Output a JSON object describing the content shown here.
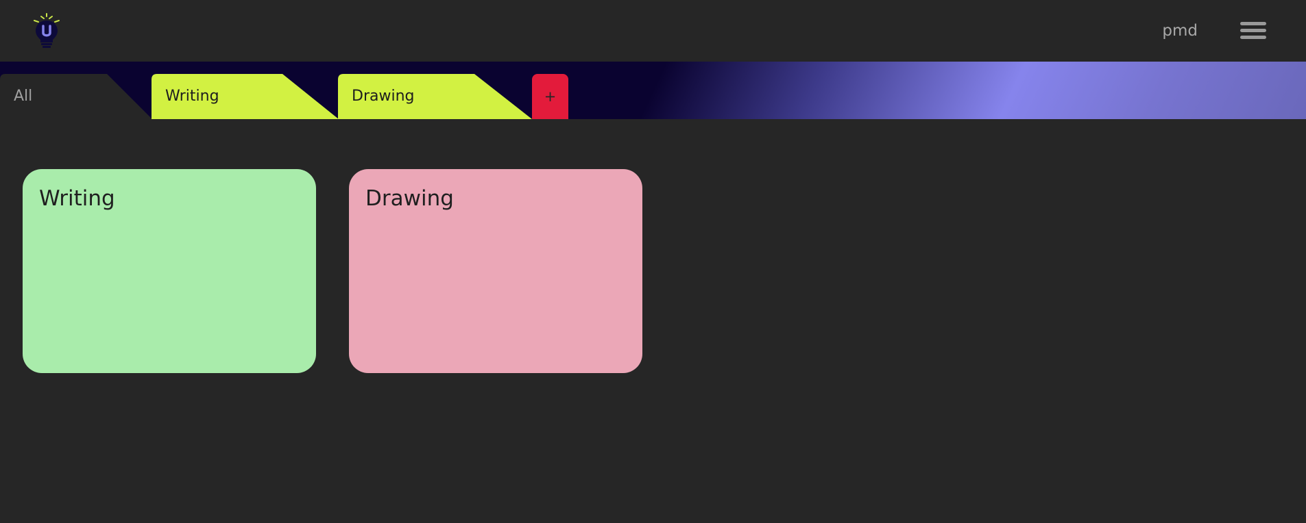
{
  "header": {
    "logo_icon": "lightbulb-logo-icon",
    "username": "pmd",
    "menu_icon": "hamburger-menu-icon"
  },
  "tabs": [
    {
      "label": "All",
      "color": "#262626",
      "active": true
    },
    {
      "label": "Writing",
      "color": "#d2f142",
      "active": false
    },
    {
      "label": "Drawing",
      "color": "#d2f142",
      "active": false
    }
  ],
  "add_tab": {
    "label": "+",
    "color": "#e31b3b"
  },
  "cards": [
    {
      "title": "Writing",
      "color": "#a9ecab"
    },
    {
      "title": "Drawing",
      "color": "#eba7b7"
    }
  ],
  "colors": {
    "background": "#262626",
    "tabbar_dark": "#0a0330",
    "tabbar_accent": "#8684ec"
  }
}
